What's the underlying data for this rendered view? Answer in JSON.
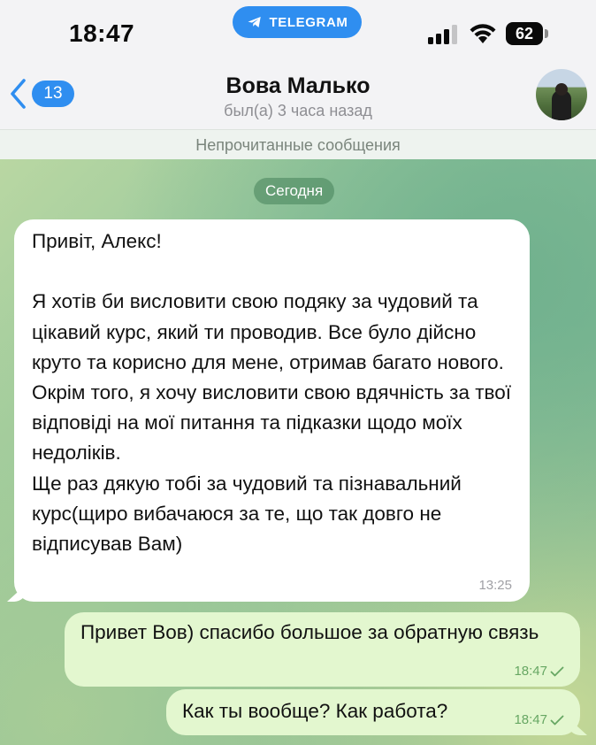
{
  "status_bar": {
    "time": "18:47",
    "app_pill": "TELEGRAM",
    "battery": "62",
    "battery_level": 0.62
  },
  "header": {
    "back_count": "13",
    "contact_name": "Вова Малько",
    "contact_status": "был(а) 3 часа назад"
  },
  "unread_label": "Непрочитанные сообщения",
  "date_label": "Сегодня",
  "messages": [
    {
      "direction": "incoming",
      "text": "Привіт, Алекс!\n\nЯ хотів би висловити свою подяку за чудовий та цікавий курс, який ти проводив. Все було дійсно круто та корисно для мене, отримав багато нового.\nОкрім того, я хочу висловити свою вдячність за твої відповіді на мої питання та підказки щодо моїх недоліків.\nЩе раз дякую тобі за чудовий та пізнавальний курс(щиро вибачаюся за те, що так довго не відписував Вам)",
      "time": "13:25"
    },
    {
      "direction": "outgoing",
      "text": "Привет Вов) спасибо большое за обратную связь",
      "time": "18:47"
    },
    {
      "direction": "outgoing",
      "text": "Как ты вообще? Как работа?",
      "time": "18:47"
    }
  ],
  "colors": {
    "accent": "#2f8ef0",
    "outgoing_bubble": "#e3f7cf",
    "read_check": "#67a763"
  }
}
